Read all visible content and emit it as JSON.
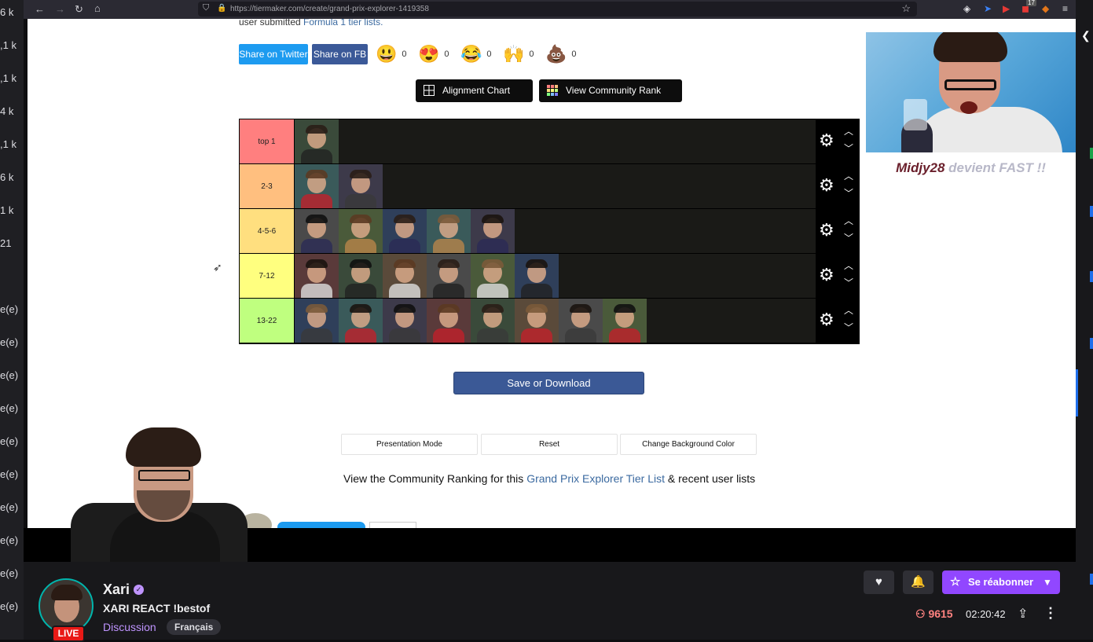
{
  "sidebar_left": {
    "labels": [
      "6 k",
      ",1 k",
      ",1 k",
      "4 k",
      ",1 k",
      "6 k",
      "1 k",
      "21",
      "e(e)",
      "e(e)",
      "e(e)",
      "e(e)",
      "e(e)",
      "e(e)",
      "e(e)",
      "e(e)",
      "e(e)",
      "e(e)"
    ]
  },
  "browser": {
    "url": "https://tiermaker.com/create/grand-prix-explorer-1419358",
    "back_icon": "←",
    "forward_icon": "→",
    "reload_icon": "↻",
    "home_icon": "⌂",
    "extension_badge": "17"
  },
  "page": {
    "top_text_prefix": "user submitted ",
    "top_text_link": "Formula 1 tier lists.",
    "share_twitter": "Share on Twitter",
    "share_fb": "Share on FB",
    "reactions": [
      {
        "emoji": "😃",
        "count": "0"
      },
      {
        "emoji": "😍",
        "count": "0"
      },
      {
        "emoji": "😂",
        "count": "0"
      },
      {
        "emoji": "🙌",
        "count": "0"
      },
      {
        "emoji": "💩",
        "count": "0"
      }
    ],
    "alignment_chart": "Alignment Chart",
    "community_rank": "View Community Rank",
    "tiers": [
      {
        "label": "top 1",
        "color": "#ff7f7f",
        "items": 1
      },
      {
        "label": "2-3",
        "color": "#ffbf7f",
        "items": 2
      },
      {
        "label": "4-5-6",
        "color": "#ffdf7f",
        "items": 5
      },
      {
        "label": "7-12",
        "color": "#ffff7f",
        "items": 6
      },
      {
        "label": "13-22",
        "color": "#bfff7f",
        "items": 8
      }
    ],
    "save_download": "Save or Download",
    "presentation_mode": "Presentation Mode",
    "reset": "Reset",
    "change_bg": "Change Background Color",
    "community_prefix": "View the Community Ranking for this ",
    "community_link": "Grand Prix Explorer Tier List",
    "community_suffix": " & recent user lists"
  },
  "overlay": {
    "caption_name": "Midjy28",
    "caption_msg": " devient FAST !!"
  },
  "channel": {
    "name": "Xari",
    "title": "XARI REACT !bestof",
    "category": "Discussion",
    "language": "Français",
    "live_badge": "LIVE",
    "resub_label": "Se réabonner",
    "viewers": "9615",
    "uptime": "02:20:42"
  },
  "colors": {
    "twitch_purple": "#9147ff",
    "live_red": "#e91916",
    "twitter_blue": "#1d9bf0",
    "fb_blue": "#3b5998"
  }
}
